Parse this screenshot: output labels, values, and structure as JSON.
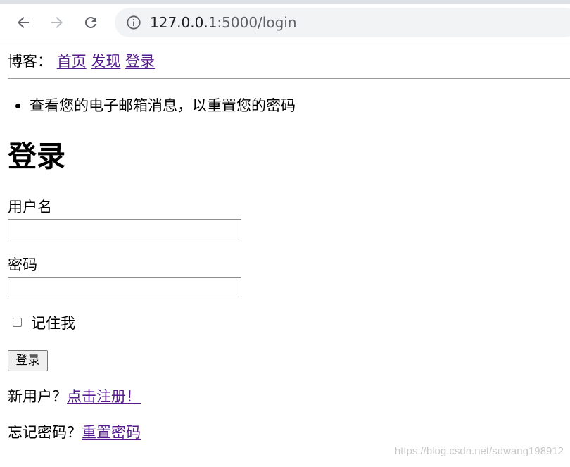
{
  "browser": {
    "url_host": "127.0.0.1",
    "url_rest": ":5000/login"
  },
  "site_nav": {
    "prefix": "博客：",
    "links": [
      "首页",
      "发现",
      "登录"
    ]
  },
  "flash_messages": [
    "查看您的电子邮箱消息，以重置您的密码"
  ],
  "login_form": {
    "title": "登录",
    "username_label": "用户名",
    "username_value": "",
    "password_label": "密码",
    "password_value": "",
    "remember_label": "记住我",
    "remember_checked": false,
    "submit_label": "登录"
  },
  "register": {
    "prompt": "新用户？",
    "link": "点击注册！"
  },
  "reset": {
    "prompt": "忘记密码？",
    "link": "重置密码"
  },
  "watermark": "https://blog.csdn.net/sdwang198912",
  "icons": {
    "back": "arrow-left-icon",
    "forward": "arrow-right-icon",
    "reload": "reload-icon",
    "site_info": "info-icon"
  },
  "colors": {
    "link_visited": "#551a8b",
    "omnibox_bg": "#f1f3f4"
  }
}
